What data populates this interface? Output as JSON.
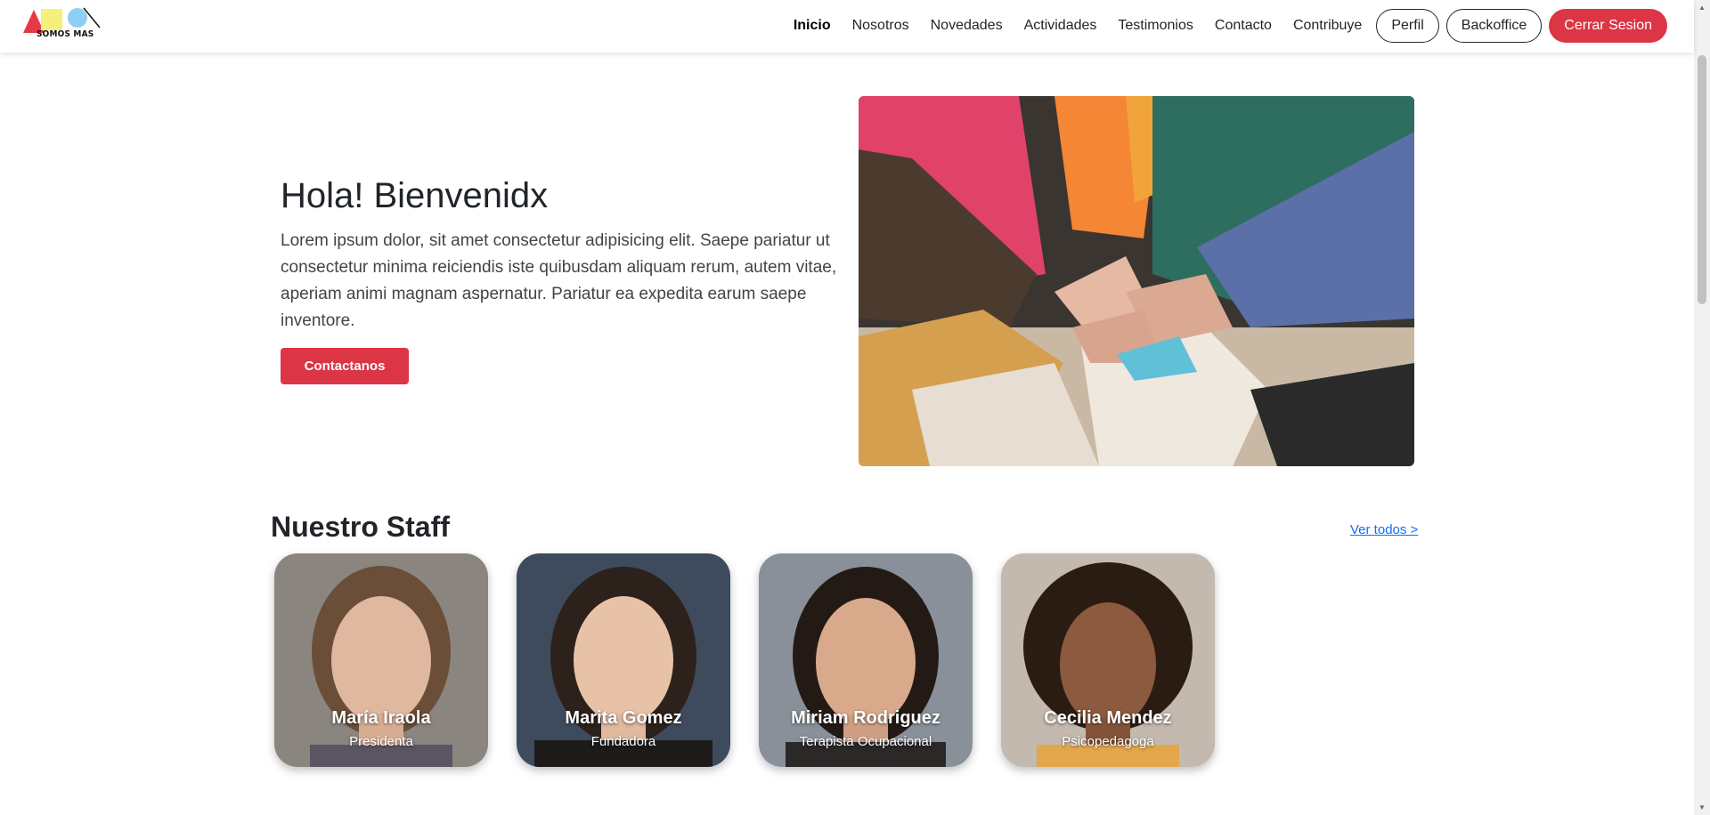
{
  "brand": {
    "logo_text": "SOMOS MAS"
  },
  "nav": {
    "links": [
      "Inicio",
      "Nosotros",
      "Novedades",
      "Actividades",
      "Testimonios",
      "Contacto",
      "Contribuye"
    ],
    "active": "Inicio",
    "profile_label": "Perfil",
    "backoffice_label": "Backoffice",
    "logout_label": "Cerrar Sesion"
  },
  "hero": {
    "title": "Hola! Bienvenidx",
    "text": "Lorem ipsum dolor, sit amet consectetur adipisicing elit. Saepe pariatur ut consectetur minima reiciendis iste quibusdam aliquam rerum, autem vitae, aperiam animi magnam aspernatur. Pariatur ea expedita earum saepe inventore.",
    "button_label": "Contactanos"
  },
  "staff": {
    "title": "Nuestro Staff",
    "see_all_label": "Ver todos >",
    "members": [
      {
        "name": "María Iraola",
        "role": "Presidenta"
      },
      {
        "name": "Marita Gomez",
        "role": "Fundadora"
      },
      {
        "name": "Miriam Rodriguez",
        "role": "Terapista Ocupacional"
      },
      {
        "name": "Cecilia Mendez",
        "role": "Psicopedagoga"
      }
    ]
  },
  "colors": {
    "accent": "#dc3545",
    "link": "#0d6efd",
    "text": "#212529"
  }
}
